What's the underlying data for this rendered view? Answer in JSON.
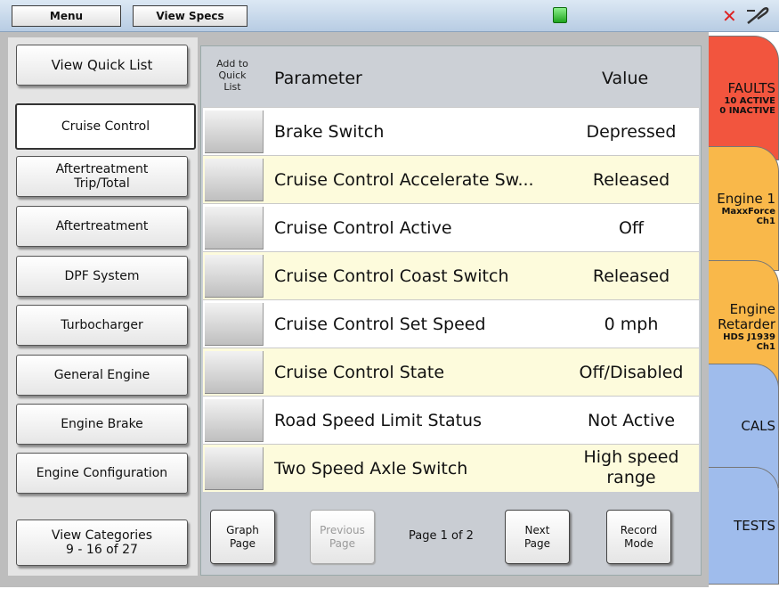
{
  "topbar": {
    "menu_label": "Menu",
    "view_specs_label": "View Specs",
    "status_icon": "green-status-light",
    "error_icon": "red-x-icon",
    "connection_icon": "connector-icon"
  },
  "sidebar": {
    "quick_list_label": "View Quick List",
    "categories": [
      "Cruise Control",
      "Aftertreatment\nTrip/Total",
      "Aftertreatment",
      "DPF System",
      "Turbocharger",
      "General Engine",
      "Engine Brake",
      "Engine Configuration"
    ],
    "selected_index": 0,
    "view_categories_line1": "View Categories",
    "view_categories_line2": "9 - 16 of 27"
  },
  "table": {
    "col_add": "Add to\nQuick\nList",
    "col_parameter": "Parameter",
    "col_value": "Value",
    "rows": [
      {
        "parameter": "Brake Switch",
        "value": "Depressed"
      },
      {
        "parameter": "Cruise Control Accelerate Sw...",
        "value": "Released"
      },
      {
        "parameter": "Cruise Control Active",
        "value": "Off"
      },
      {
        "parameter": "Cruise Control Coast Switch",
        "value": "Released"
      },
      {
        "parameter": "Cruise Control Set Speed",
        "value": "0 mph"
      },
      {
        "parameter": "Cruise Control State",
        "value": "Off/Disabled"
      },
      {
        "parameter": "Road Speed Limit Status",
        "value": "Not Active"
      },
      {
        "parameter": "Two Speed Axle Switch",
        "value": "High speed\nrange"
      }
    ]
  },
  "footer": {
    "graph_page": "Graph\nPage",
    "previous_page": "Previous\nPage",
    "page_indicator": "Page 1 of 2",
    "next_page": "Next\nPage",
    "record_mode": "Record\nMode"
  },
  "tabs": {
    "faults": {
      "title": "FAULTS",
      "line2": "10 ACTIVE",
      "line3": "0 INACTIVE",
      "color": "#f2553e"
    },
    "engine1": {
      "title": "Engine 1",
      "line2": "MaxxForce",
      "line3": "Ch1",
      "color": "#f9b84a"
    },
    "retarder": {
      "title": "Engine\nRetarder",
      "line2": "HDS J1939",
      "line3": "Ch1",
      "color": "#f9b84a"
    },
    "cals": {
      "title": "CALS",
      "color": "#9fbcec"
    },
    "tests": {
      "title": "TESTS",
      "color": "#9fbcec"
    }
  }
}
